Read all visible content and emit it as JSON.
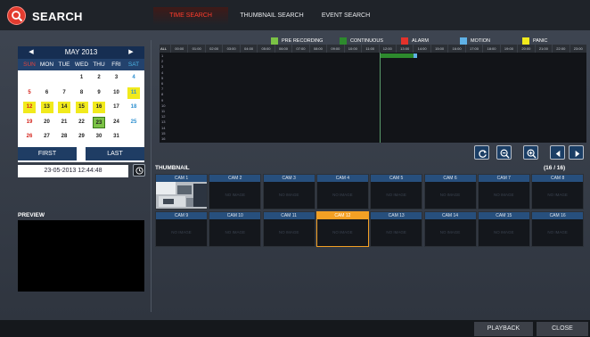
{
  "app": {
    "title": "SEARCH",
    "logo_icon": "search-icon"
  },
  "tabs": [
    {
      "label": "TIME SEARCH",
      "active": true
    },
    {
      "label": "THUMBNAIL SEARCH",
      "active": false
    },
    {
      "label": "EVENT SEARCH",
      "active": false
    }
  ],
  "calendar": {
    "month_label": "MAY 2013",
    "weekdays": [
      "SUN",
      "MON",
      "TUE",
      "WED",
      "THU",
      "FRI",
      "SAT"
    ],
    "weeks": [
      [
        "",
        "",
        "",
        "1",
        "2",
        "3",
        "4"
      ],
      [
        "5",
        "6",
        "7",
        "8",
        "9",
        "10",
        "11"
      ],
      [
        "12",
        "13",
        "14",
        "15",
        "16",
        "17",
        "18"
      ],
      [
        "19",
        "20",
        "21",
        "22",
        "23",
        "24",
        "25"
      ],
      [
        "26",
        "27",
        "28",
        "29",
        "30",
        "31",
        ""
      ],
      [
        "",
        "",
        "",
        "",
        "",
        "",
        ""
      ]
    ],
    "recorded_days": [
      "11",
      "12",
      "13",
      "14",
      "15",
      "16"
    ],
    "selected_day": "23",
    "first_label": "FIRST",
    "last_label": "LAST"
  },
  "datetime": {
    "value": "23-05-2013  12:44:48",
    "button_icon": "clock-icon"
  },
  "preview": {
    "label": "PREVIEW"
  },
  "legend": [
    {
      "label": "PRE RECORDING",
      "color": "#7bc245"
    },
    {
      "label": "CONTINUOUS",
      "color": "#2d8a2d"
    },
    {
      "label": "ALARM",
      "color": "#e4322b"
    },
    {
      "label": "MOTION",
      "color": "#5fb1e6"
    },
    {
      "label": "PANIC",
      "color": "#f1ea1c"
    }
  ],
  "timeline": {
    "all_label": "ALL",
    "hours": [
      "00:00",
      "01:00",
      "02:00",
      "03:00",
      "04:00",
      "05:00",
      "06:00",
      "07:00",
      "08:00",
      "09:00",
      "10:00",
      "11:00",
      "12:00",
      "13:00",
      "14:00",
      "15:00",
      "16:00",
      "17:00",
      "18:00",
      "19:00",
      "20:00",
      "21:00",
      "22:00",
      "23:00"
    ],
    "channels": [
      "1",
      "2",
      "3",
      "4",
      "5",
      "6",
      "7",
      "8",
      "9",
      "10",
      "11",
      "12",
      "13",
      "14",
      "15",
      "16"
    ],
    "buttons": [
      "refresh-icon",
      "zoom-out-icon",
      "zoom-in-icon",
      "prev-icon",
      "next-icon"
    ]
  },
  "thumbnail": {
    "label": "THUMBNAIL",
    "count": "(16 / 16)",
    "no_image_text": "NO IMAGE",
    "cameras": [
      "CAM 1",
      "CAM 2",
      "CAM 3",
      "CAM 4",
      "CAM 5",
      "CAM 6",
      "CAM 7",
      "CAM 8",
      "CAM 9",
      "CAM 10",
      "CAM 11",
      "CAM 12",
      "CAM 13",
      "CAM 14",
      "CAM 15",
      "CAM 16"
    ],
    "active_camera": "CAM 12",
    "camera_with_image": "CAM 1"
  },
  "footer": {
    "playback_label": "PLAYBACK",
    "close_label": "CLOSE"
  }
}
